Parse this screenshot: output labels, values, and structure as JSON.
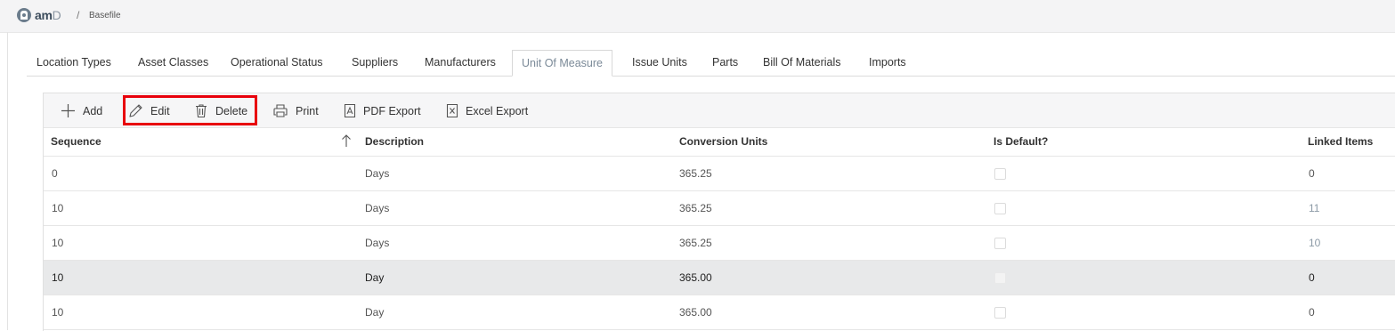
{
  "header": {
    "logo_text_bold": "am",
    "logo_text_light": "D",
    "breadcrumb_sep": "/",
    "breadcrumb": "Basefile"
  },
  "tabs": [
    {
      "label": "Location Types"
    },
    {
      "label": "Asset Classes"
    },
    {
      "label": "Operational Status"
    },
    {
      "label": "Suppliers"
    },
    {
      "label": "Manufacturers"
    },
    {
      "label": "Unit Of Measure",
      "active": true
    },
    {
      "label": "Issue Units"
    },
    {
      "label": "Parts"
    },
    {
      "label": "Bill Of Materials"
    },
    {
      "label": "Imports"
    }
  ],
  "toolbar": {
    "add": "Add",
    "edit": "Edit",
    "delete": "Delete",
    "print": "Print",
    "pdf_export": "PDF Export",
    "excel_export": "Excel Export",
    "highlight_color": "#e8000b"
  },
  "columns": {
    "sequence": "Sequence",
    "description": "Description",
    "conversion_units": "Conversion Units",
    "is_default": "Is Default?",
    "linked_items": "Linked Items"
  },
  "rows": [
    {
      "sequence": "0",
      "description": "Days",
      "conversion_units": "365.25",
      "linked_items": "0"
    },
    {
      "sequence": "10",
      "description": "Days",
      "conversion_units": "365.25",
      "linked_items": "11"
    },
    {
      "sequence": "10",
      "description": "Days",
      "conversion_units": "365.25",
      "linked_items": "10"
    },
    {
      "sequence": "10",
      "description": "Day",
      "conversion_units": "365.00",
      "linked_items": "0",
      "selected": true
    },
    {
      "sequence": "10",
      "description": "Day",
      "conversion_units": "365.00",
      "linked_items": "0"
    }
  ]
}
